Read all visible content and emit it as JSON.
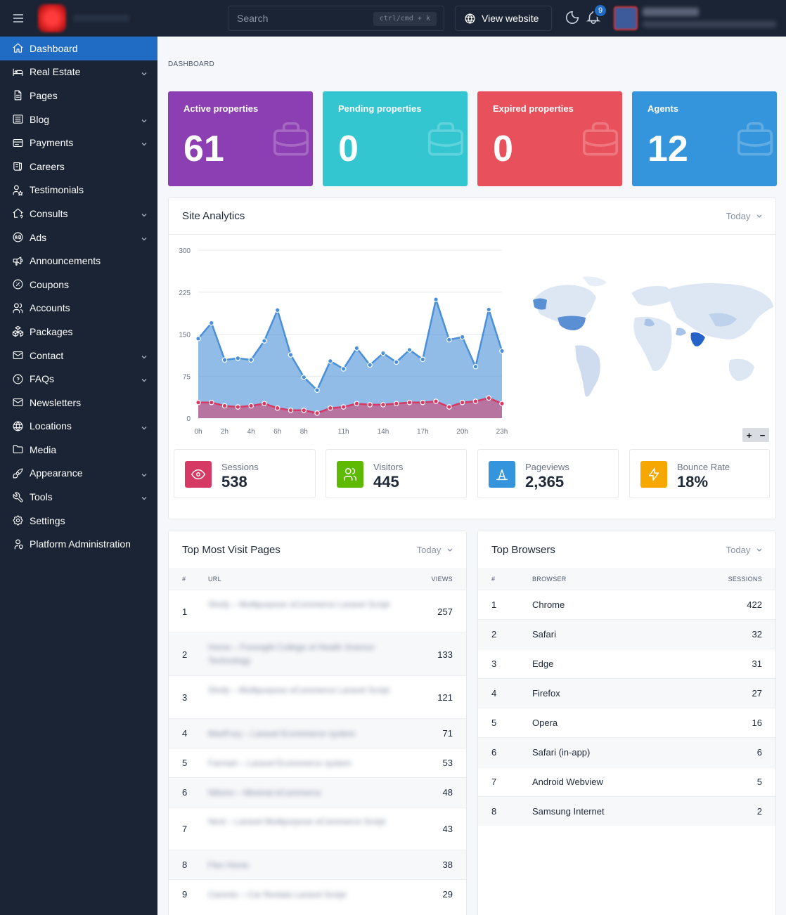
{
  "topbar": {
    "search_placeholder": "Search",
    "search_shortcut": "ctrl/cmd + k",
    "view_website_label": "View website",
    "notification_count": "9"
  },
  "sidebar": {
    "items": [
      {
        "label": "Dashboard",
        "icon": "home-icon",
        "active": true,
        "has_children": false
      },
      {
        "label": "Real Estate",
        "icon": "bed-icon",
        "has_children": true
      },
      {
        "label": "Pages",
        "icon": "file-icon",
        "has_children": false
      },
      {
        "label": "Blog",
        "icon": "article-icon",
        "has_children": true
      },
      {
        "label": "Payments",
        "icon": "credit-card-icon",
        "has_children": true
      },
      {
        "label": "Careers",
        "icon": "news-icon",
        "has_children": false
      },
      {
        "label": "Testimonials",
        "icon": "user-star-icon",
        "has_children": false
      },
      {
        "label": "Consults",
        "icon": "home-question-icon",
        "has_children": true
      },
      {
        "label": "Ads",
        "icon": "ad-circle-icon",
        "has_children": true
      },
      {
        "label": "Announcements",
        "icon": "speakerphone-icon",
        "has_children": false
      },
      {
        "label": "Coupons",
        "icon": "discount-icon",
        "has_children": false
      },
      {
        "label": "Accounts",
        "icon": "users-icon",
        "has_children": false
      },
      {
        "label": "Packages",
        "icon": "packages-icon",
        "has_children": false
      },
      {
        "label": "Contact",
        "icon": "mail-icon",
        "has_children": true
      },
      {
        "label": "FAQs",
        "icon": "help-circle-icon",
        "has_children": true
      },
      {
        "label": "Newsletters",
        "icon": "mail-icon",
        "has_children": false
      },
      {
        "label": "Locations",
        "icon": "world-icon",
        "has_children": true
      },
      {
        "label": "Media",
        "icon": "folder-icon",
        "has_children": false
      },
      {
        "label": "Appearance",
        "icon": "brush-icon",
        "has_children": true
      },
      {
        "label": "Tools",
        "icon": "tool-icon",
        "has_children": true
      },
      {
        "label": "Settings",
        "icon": "settings-icon",
        "has_children": false
      },
      {
        "label": "Platform Administration",
        "icon": "user-shield-icon",
        "has_children": false
      }
    ]
  },
  "breadcrumb": "DASHBOARD",
  "stats": [
    {
      "label": "Active properties",
      "value": "61",
      "color": "#8c3fb3"
    },
    {
      "label": "Pending properties",
      "value": "0",
      "color": "#33c6d1"
    },
    {
      "label": "Expired properties",
      "value": "0",
      "color": "#e8505b"
    },
    {
      "label": "Agents",
      "value": "12",
      "color": "#3595dc"
    }
  ],
  "analytics": {
    "title": "Site Analytics",
    "period": "Today",
    "zoom_in": "+",
    "zoom_out": "−",
    "metrics": [
      {
        "label": "Sessions",
        "value": "538",
        "color": "#d63964",
        "icon": "eye-icon"
      },
      {
        "label": "Visitors",
        "value": "445",
        "color": "#5eba00",
        "icon": "users-icon"
      },
      {
        "label": "Pageviews",
        "value": "2,365",
        "color": "#3595dc",
        "icon": "letter-a-icon"
      },
      {
        "label": "Bounce Rate",
        "value": "18%",
        "color": "#f6a700",
        "icon": "bolt-icon"
      }
    ]
  },
  "chart_data": {
    "type": "area",
    "x": [
      "0h",
      "1h",
      "2h",
      "3h",
      "4h",
      "5h",
      "6h",
      "7h",
      "8h",
      "9h",
      "10h",
      "11h",
      "12h",
      "13h",
      "14h",
      "15h",
      "16h",
      "17h",
      "18h",
      "19h",
      "20h",
      "21h",
      "22h",
      "23h"
    ],
    "x_tick_labels": [
      "0h",
      "2h",
      "4h",
      "6h",
      "8h",
      "11h",
      "14h",
      "17h",
      "20h",
      "23h"
    ],
    "y_tick_labels": [
      "0",
      "75",
      "150",
      "225",
      "300"
    ],
    "ylim": [
      0,
      300
    ],
    "grid": true,
    "series": [
      {
        "name": "Sessions",
        "color": "#4a90d9",
        "values": [
          142,
          170,
          104,
          107,
          104,
          138,
          193,
          113,
          73,
          50,
          102,
          88,
          125,
          95,
          116,
          100,
          122,
          105,
          212,
          140,
          145,
          92,
          194,
          120
        ]
      },
      {
        "name": "",
        "color": "#d63964",
        "values": [
          28,
          28,
          22,
          20,
          22,
          26,
          18,
          14,
          14,
          9,
          18,
          20,
          26,
          24,
          24,
          26,
          28,
          28,
          30,
          20,
          28,
          30,
          36,
          26
        ]
      }
    ]
  },
  "top_pages": {
    "title": "Top Most Visit Pages",
    "period": "Today",
    "headers": {
      "num": "#",
      "url": "URL",
      "views": "VIEWS"
    },
    "rows": [
      {
        "num": "1",
        "url": "Shofy – Multipurpose eCommerce Laravel Script",
        "views": "257"
      },
      {
        "num": "2",
        "url": "Home – Foresight College of Health Science Technology",
        "views": "133"
      },
      {
        "num": "3",
        "url": "Shofy – Multipurpose eCommerce Laravel Script",
        "views": "121"
      },
      {
        "num": "4",
        "url": "MartFury – Laravel Ecommerce system",
        "views": "71"
      },
      {
        "num": "5",
        "url": "Farmart – Laravel Ecommerce system",
        "views": "53"
      },
      {
        "num": "6",
        "url": "Nifsmo – Minimal eCommerce",
        "views": "48"
      },
      {
        "num": "7",
        "url": "Nest – Laravel Multipurpose eCommerce Script",
        "views": "43"
      },
      {
        "num": "8",
        "url": "Flex Home",
        "views": "38"
      },
      {
        "num": "9",
        "url": "Carento – Car Rentals Laravel Script",
        "views": "29"
      }
    ]
  },
  "top_browsers": {
    "title": "Top Browsers",
    "period": "Today",
    "headers": {
      "num": "#",
      "browser": "BROWSER",
      "sessions": "SESSIONS"
    },
    "rows": [
      {
        "num": "1",
        "browser": "Chrome",
        "sessions": "422"
      },
      {
        "num": "2",
        "browser": "Safari",
        "sessions": "32"
      },
      {
        "num": "3",
        "browser": "Edge",
        "sessions": "31"
      },
      {
        "num": "4",
        "browser": "Firefox",
        "sessions": "27"
      },
      {
        "num": "5",
        "browser": "Opera",
        "sessions": "16"
      },
      {
        "num": "6",
        "browser": "Safari (in-app)",
        "sessions": "6"
      },
      {
        "num": "7",
        "browser": "Android Webview",
        "sessions": "5"
      },
      {
        "num": "8",
        "browser": "Samsung Internet",
        "sessions": "2"
      }
    ]
  }
}
